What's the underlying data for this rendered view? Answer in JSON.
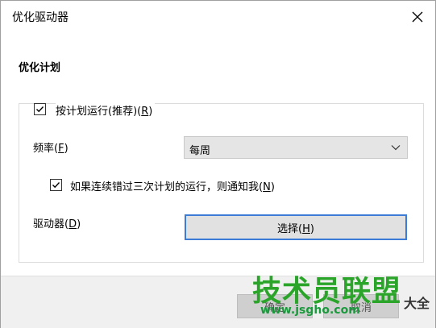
{
  "window": {
    "title": "优化驱动器"
  },
  "section": {
    "heading": "优化计划"
  },
  "schedule": {
    "run_label": "按计划运行(推荐)(",
    "run_key": "R",
    "run_tail": ")",
    "run_checked": true
  },
  "frequency": {
    "label": "频率(",
    "key": "F",
    "tail": ")",
    "selected": "每周"
  },
  "notify": {
    "label": "如果连续错过三次计划的运行，则通知我(",
    "key": "N",
    "tail": ")",
    "checked": true
  },
  "drives": {
    "label": "驱动器(",
    "key": "D",
    "tail": ")",
    "button_label": "选择(",
    "button_key": "H",
    "button_tail": ")"
  },
  "footer": {
    "ok_label": "确定",
    "cancel_label": "取消"
  },
  "watermark": {
    "logo": "技术员联盟",
    "url": "www.jsgho.com",
    "tail": "大全"
  },
  "colors": {
    "focus_border": "#3c7bd6",
    "watermark_green": "#2aa52a"
  }
}
